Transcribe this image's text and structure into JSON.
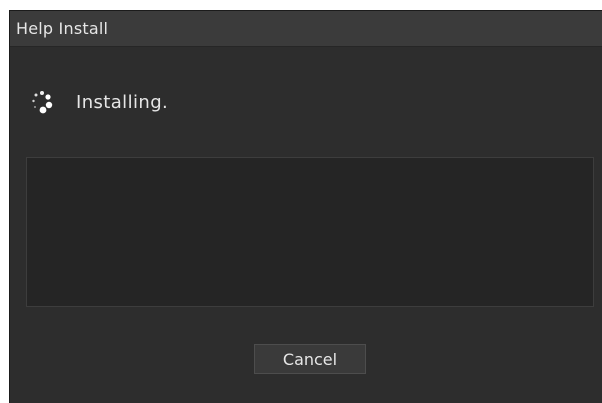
{
  "window": {
    "title": "Help Install"
  },
  "status": {
    "icon": "loading-spinner-icon",
    "text": "Installing."
  },
  "log": {
    "text": ""
  },
  "actions": {
    "cancel_label": "Cancel"
  }
}
